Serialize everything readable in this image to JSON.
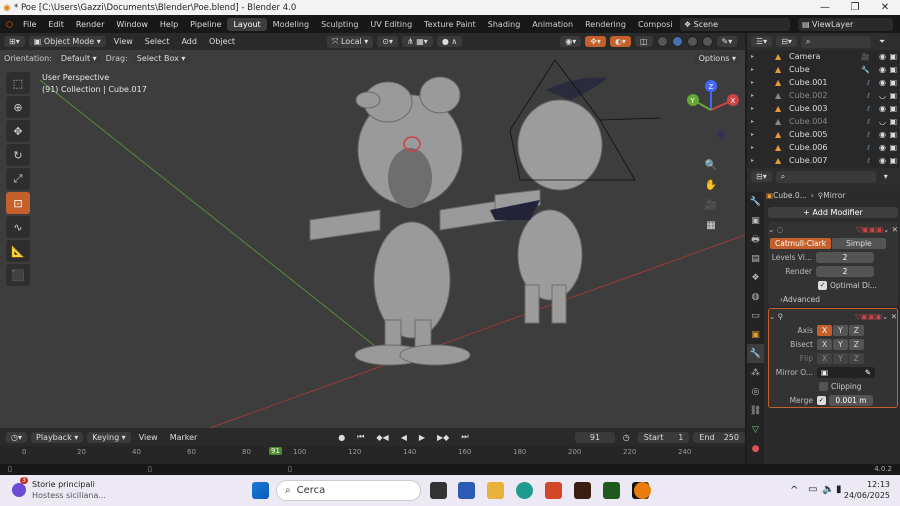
{
  "window": {
    "title": "* Poe [C:\\Users\\Gazzi\\Documents\\Blender\\Poe.blend] - Blender 4.0",
    "controls": [
      "—",
      "❐",
      "✕"
    ]
  },
  "menubar": {
    "menus": [
      "File",
      "Edit",
      "Render",
      "Window",
      "Help",
      "Pipeline"
    ],
    "workspaces": [
      "Layout",
      "Modeling",
      "Sculpting",
      "UV Editing",
      "Texture Paint",
      "Shading",
      "Animation",
      "Rendering",
      "Compositing"
    ],
    "active_workspace": "Layout",
    "scene": "Scene",
    "view_layer": "ViewLayer"
  },
  "viewport_header": {
    "mode": "Object Mode",
    "menus": [
      "View",
      "Select",
      "Add",
      "Object"
    ],
    "transform": "Local",
    "orientation_label": "Orientation:",
    "orientation": "Default",
    "drag_label": "Drag:",
    "drag": "Select Box",
    "options": "Options"
  },
  "viewport": {
    "perspective": "User Perspective",
    "collection_info": "(91) Collection | Cube.017",
    "gizmo": {
      "x": "X",
      "y": "Y",
      "z": "Z"
    }
  },
  "timeline": {
    "menus": [
      "Playback",
      "Keying",
      "View",
      "Marker"
    ],
    "current_frame": "91",
    "start_label": "Start",
    "start": "1",
    "end_label": "End",
    "end": "250",
    "ruler": [
      "0",
      "20",
      "40",
      "60",
      "80",
      "91",
      "100",
      "120",
      "140",
      "160",
      "180",
      "200",
      "220",
      "240"
    ]
  },
  "status": {
    "version": "4.0.2"
  },
  "outliner": {
    "search_placeholder": "",
    "items": [
      {
        "name": "Camera",
        "dim": false
      },
      {
        "name": "Cube",
        "dim": false
      },
      {
        "name": "Cube.001",
        "dim": false
      },
      {
        "name": "Cube.002",
        "dim": true
      },
      {
        "name": "Cube.003",
        "dim": false
      },
      {
        "name": "Cube.004",
        "dim": true
      },
      {
        "name": "Cube.005",
        "dim": false
      },
      {
        "name": "Cube.006",
        "dim": false
      },
      {
        "name": "Cube.007",
        "dim": false
      }
    ]
  },
  "properties": {
    "object": "Cube.0...",
    "modifier_name": "Mirror",
    "add_modifier": "Add Modifier",
    "subsurf": {
      "catmull_clark": "Catmull-Clark",
      "simple": "Simple",
      "levels_label": "Levels Vi...",
      "levels": "2",
      "render_label": "Render",
      "render": "2",
      "optimal": "Optimal Di...",
      "advanced": "Advanced"
    },
    "mirror": {
      "axis_label": "Axis",
      "bisect_label": "Bisect",
      "flip_label": "Flip",
      "axes": [
        "X",
        "Y",
        "Z"
      ],
      "mirror_obj_label": "Mirror O...",
      "clipping": "Clipping",
      "merge_label": "Merge",
      "merge": "0.001 m"
    }
  },
  "taskbar": {
    "news_title": "Storie principali",
    "news_sub": "Hostess siciliana...",
    "badge": "3",
    "search": "Cerca",
    "time": "12:13",
    "date": "24/06/2025",
    "tray": "^"
  }
}
